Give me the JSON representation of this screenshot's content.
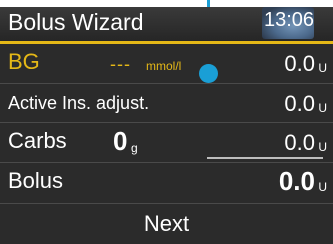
{
  "header": {
    "title": "Bolus Wizard",
    "time": "13:06"
  },
  "rows": {
    "bg": {
      "label": "BG",
      "value_placeholder": "---",
      "value_unit": "mmol/l",
      "amount": "0.0",
      "amount_unit": "U"
    },
    "active_ins": {
      "label": "Active Ins. adjust.",
      "amount": "0.0",
      "amount_unit": "U"
    },
    "carbs": {
      "label": "Carbs",
      "value": "0",
      "value_unit": "g",
      "amount": "0.0",
      "amount_unit": "U"
    },
    "bolus": {
      "label": "Bolus",
      "amount": "0.0",
      "amount_unit": "U"
    }
  },
  "next_label": "Next",
  "colors": {
    "accent": "#e5b817",
    "callout": "#1a9fd6",
    "background": "#2b2b2b"
  }
}
